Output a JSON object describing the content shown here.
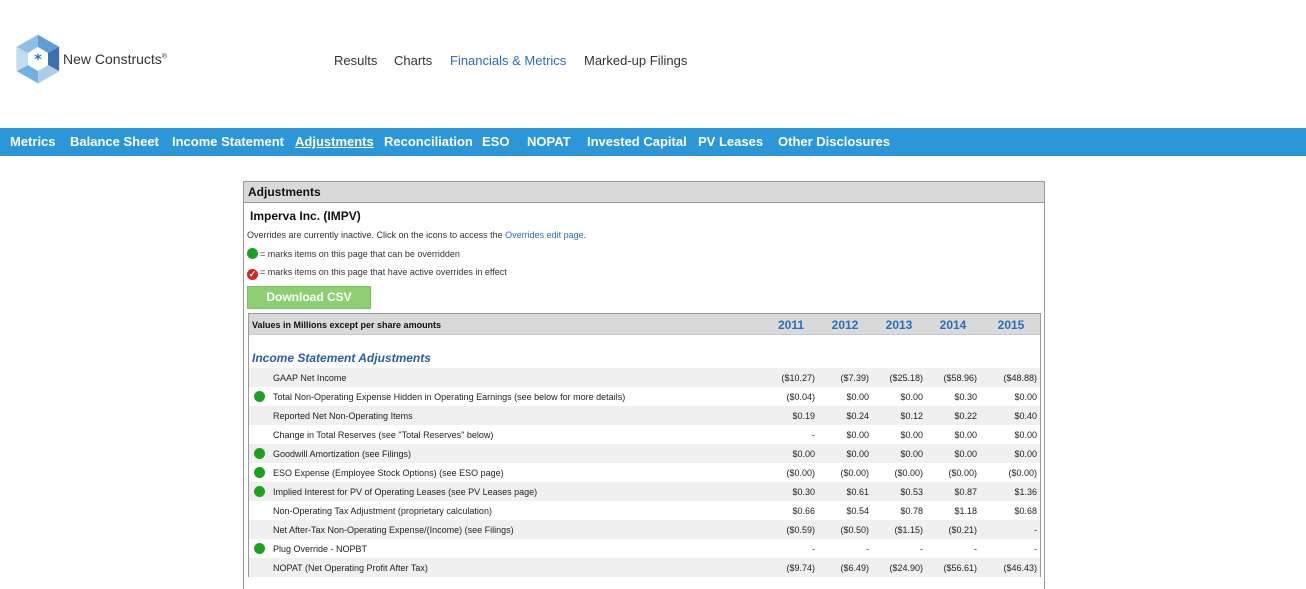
{
  "brand": {
    "name": "New Constructs",
    "mark": "®"
  },
  "topnav": [
    {
      "label": "Results",
      "active": false
    },
    {
      "label": "Charts",
      "active": false
    },
    {
      "label": "Financials & Metrics",
      "active": true
    },
    {
      "label": "Marked-up Filings",
      "active": false
    }
  ],
  "subnav": [
    {
      "label": "Metrics",
      "active": false
    },
    {
      "label": "Balance Sheet",
      "active": false
    },
    {
      "label": "Income Statement",
      "active": false
    },
    {
      "label": "Adjustments",
      "active": true
    },
    {
      "label": "Reconciliation",
      "active": false
    },
    {
      "label": "ESO",
      "active": false
    },
    {
      "label": "NOPAT",
      "active": false
    },
    {
      "label": "Invested Capital",
      "active": false
    },
    {
      "label": "PV Leases",
      "active": false
    },
    {
      "label": "Other Disclosures",
      "active": false
    }
  ],
  "panel": {
    "title": "Adjustments",
    "company": "Imperva Inc. (IMPV)",
    "overrides_note": "Overrides are currently inactive. Click on the icons to access the",
    "overrides_link": "Overrides edit page",
    "overrides_tail": ".",
    "legend_overridable": "= marks items on this page that can be overridden",
    "legend_active": "= marks items on this page that have active overrides in effect",
    "download_label": "Download CSV"
  },
  "table": {
    "header_label": "Values in Millions except per share amounts",
    "years": [
      "2011",
      "2012",
      "2013",
      "2014",
      "2015"
    ],
    "section_title": "Income Statement Adjustments",
    "rows": [
      {
        "name": "GAAP Net Income",
        "icon": false,
        "values": [
          "($10.27)",
          "($7.39)",
          "($25.18)",
          "($58.96)",
          "($48.88)"
        ]
      },
      {
        "name": "Total Non-Operating Expense Hidden in Operating Earnings (see below for more details)",
        "icon": true,
        "values": [
          "($0.04)",
          "$0.00",
          "$0.00",
          "$0.30",
          "$0.00"
        ]
      },
      {
        "name": "Reported Net Non-Operating Items",
        "icon": false,
        "values": [
          "$0.19",
          "$0.24",
          "$0.12",
          "$0.22",
          "$0.40"
        ]
      },
      {
        "name": "Change in Total Reserves (see \"Total Reserves\" below)",
        "icon": false,
        "values": [
          "-",
          "$0.00",
          "$0.00",
          "$0.00",
          "$0.00"
        ]
      },
      {
        "name": "Goodwill Amortization (see Filings)",
        "icon": true,
        "values": [
          "$0.00",
          "$0.00",
          "$0.00",
          "$0.00",
          "$0.00"
        ]
      },
      {
        "name": "ESO Expense (Employee Stock Options) (see ESO page)",
        "icon": true,
        "values": [
          "($0.00)",
          "($0.00)",
          "($0.00)",
          "($0.00)",
          "($0.00)"
        ]
      },
      {
        "name": "Implied Interest for PV of Operating Leases (see PV Leases page)",
        "icon": true,
        "values": [
          "$0.30",
          "$0.61",
          "$0.53",
          "$0.87",
          "$1.36"
        ]
      },
      {
        "name": "Non-Operating Tax Adjustment (proprietary calculation)",
        "icon": false,
        "values": [
          "$0.66",
          "$0.54",
          "$0.78",
          "$1.18",
          "$0.68"
        ]
      },
      {
        "name": "Net After-Tax Non-Operating Expense/(Income) (see Filings)",
        "icon": false,
        "values": [
          "($0.59)",
          "($0.50)",
          "($1.15)",
          "($0.21)",
          "-"
        ]
      },
      {
        "name": "Plug Override - NOPBT",
        "icon": true,
        "values": [
          "-",
          "-",
          "-",
          "-",
          "-"
        ]
      },
      {
        "name": "NOPAT (Net Operating Profit After Tax)",
        "icon": false,
        "values": [
          "($9.74)",
          "($6.49)",
          "($24.90)",
          "($56.61)",
          "($46.43)"
        ]
      }
    ]
  },
  "colors": {
    "subnav_bg": "#2b97d9",
    "link": "#2a6ebb",
    "override_dot": "#1aa31a",
    "active_override": "#d92020",
    "csv_button": "#8fcf73"
  }
}
